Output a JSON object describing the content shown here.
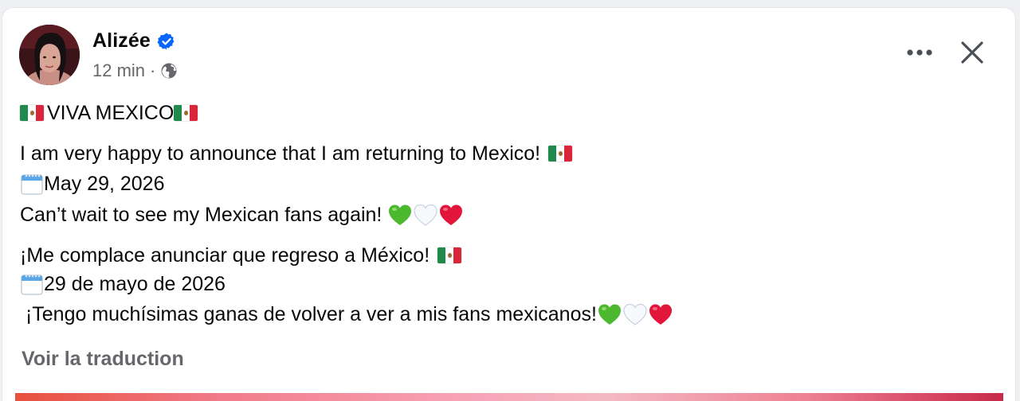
{
  "post": {
    "author": "Alizée",
    "time": "12 min",
    "separator": "·",
    "privacy_icon": "globe-icon",
    "verified_icon": "verified-badge-icon",
    "lines": {
      "title": "VIVA MEXICO",
      "en_1": "I am very happy to announce that I am returning to Mexico! ",
      "en_2": "May 29, 2026",
      "en_3": "Can’t wait to see my Mexican fans again! ",
      "es_1": "¡Me complace anunciar que regreso a México! ",
      "es_2": "29 de mayo de 2026",
      "es_3": " ¡Tengo muchísimas ganas de volver a ver a mis fans mexicanos!"
    },
    "emoji": {
      "flag": "mexico-flag-icon",
      "calendar": "calendar-icon",
      "hearts": [
        "green-heart-icon",
        "white-heart-icon",
        "red-heart-icon"
      ]
    },
    "translate_label": "Voir la traduction"
  },
  "actions": {
    "more_icon": "more-options-icon",
    "close_icon": "close-icon"
  },
  "colors": {
    "text": "#080809",
    "secondary": "#65676b",
    "verified": "#0866ff",
    "green_heart": "#4cb82f",
    "red_heart": "#e1163a"
  }
}
